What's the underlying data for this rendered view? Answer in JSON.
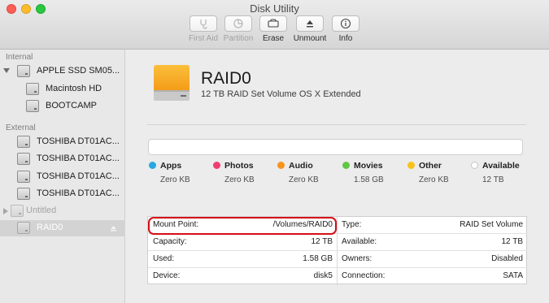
{
  "window": {
    "title": "Disk Utility"
  },
  "toolbar": [
    {
      "label": "First Aid",
      "icon": "stethoscope-icon",
      "enabled": false
    },
    {
      "label": "Partition",
      "icon": "pie-chart-icon",
      "enabled": false
    },
    {
      "label": "Erase",
      "icon": "erase-icon",
      "enabled": true
    },
    {
      "label": "Unmount",
      "icon": "eject-icon",
      "enabled": true
    },
    {
      "label": "Info",
      "icon": "info-icon",
      "enabled": true
    }
  ],
  "sidebar": {
    "internal_header": "Internal",
    "external_header": "External",
    "items": [
      {
        "label": "APPLE SSD SM05...",
        "level": 0,
        "expanded": true
      },
      {
        "label": "Macintosh HD",
        "level": 1
      },
      {
        "label": "BOOTCAMP",
        "level": 1
      },
      {
        "label": "TOSHIBA DT01AC...",
        "level": 0
      },
      {
        "label": "TOSHIBA DT01AC...",
        "level": 0
      },
      {
        "label": "TOSHIBA DT01AC...",
        "level": 0
      },
      {
        "label": "TOSHIBA DT01AC...",
        "level": 0
      },
      {
        "label": "Untitled",
        "level": 0,
        "collapsed": true,
        "dimmed": true
      },
      {
        "label": "RAID0",
        "level": 1,
        "selected": true
      }
    ]
  },
  "volume": {
    "name": "RAID0",
    "description": "12 TB RAID Set Volume OS X Extended"
  },
  "usage": [
    {
      "name": "Apps",
      "size": "Zero KB",
      "color": "#27a9e1"
    },
    {
      "name": "Photos",
      "size": "Zero KB",
      "color": "#ef3e6e"
    },
    {
      "name": "Audio",
      "size": "Zero KB",
      "color": "#f7941d"
    },
    {
      "name": "Movies",
      "size": "1.58 GB",
      "color": "#5fc744"
    },
    {
      "name": "Other",
      "size": "Zero KB",
      "color": "#f8c21c"
    },
    {
      "name": "Available",
      "size": "12 TB",
      "color": "#ffffff"
    }
  ],
  "info": {
    "left": [
      {
        "key": "Mount Point:",
        "value": "/Volumes/RAID0"
      },
      {
        "key": "Capacity:",
        "value": "12 TB"
      },
      {
        "key": "Used:",
        "value": "1.58 GB"
      },
      {
        "key": "Device:",
        "value": "disk5"
      }
    ],
    "right": [
      {
        "key": "Type:",
        "value": "RAID Set Volume"
      },
      {
        "key": "Available:",
        "value": "12 TB"
      },
      {
        "key": "Owners:",
        "value": "Disabled"
      },
      {
        "key": "Connection:",
        "value": "SATA"
      }
    ]
  },
  "colors": {
    "highlight": "#d50f16",
    "disk_orange": "#f7a823"
  }
}
